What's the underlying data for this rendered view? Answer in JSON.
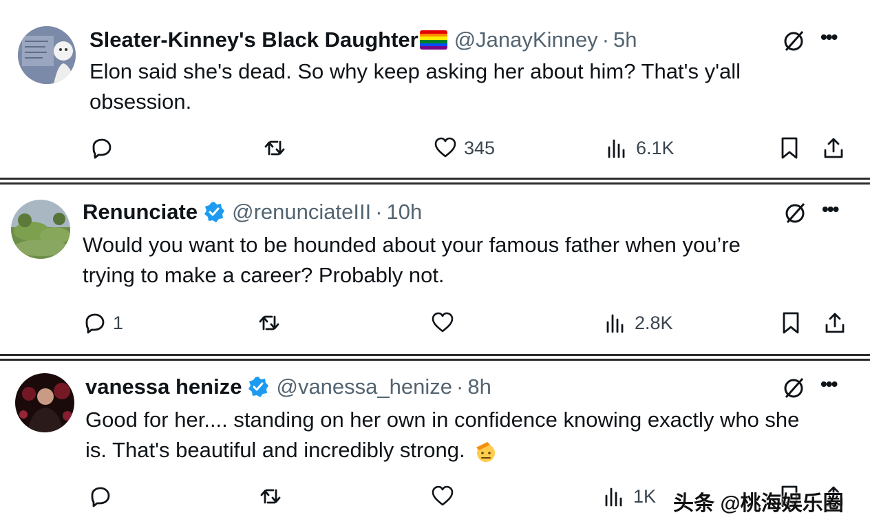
{
  "tweets": [
    {
      "name": "Sleater-Kinney's Black Daughter",
      "handle": "@JanayKinney",
      "separator": "·",
      "time": "5h",
      "text_line1": "Elon said she's dead. So why keep asking her about him? That's y'all",
      "text_line2": "obsession.",
      "reply_count": "",
      "like_count": "345",
      "view_count": "6.1K",
      "verified": false
    },
    {
      "name": "Renunciate",
      "handle": "@renunciateIII",
      "separator": "·",
      "time": "10h",
      "text_line1": "Would you want to be hounded about your famous father when you’re",
      "text_line2": "trying to make a career? Probably not.",
      "reply_count": "1",
      "like_count": "",
      "view_count": "2.8K",
      "verified": true
    },
    {
      "name": "vanessa henize",
      "handle": "@vanessa_henize",
      "separator": "·",
      "time": "8h",
      "text_line1": "Good for her.... standing on her own in confidence knowing exactly who she",
      "text_line2": "is. That's beautiful and incredibly strong.",
      "reply_count": "",
      "like_count": "",
      "view_count": "1K",
      "verified": true
    }
  ],
  "icons": {
    "reply": "reply-icon",
    "retweet": "retweet-icon",
    "like": "heart-icon",
    "views": "views-icon",
    "bookmark": "bookmark-icon",
    "share": "share-icon",
    "grok": "grok-icon",
    "more": "more-icon"
  },
  "watermark": "头条 @桃海娱乐圈",
  "colors": {
    "text": "#0f1419",
    "secondary": "#536471",
    "verified": "#1d9bf0",
    "divider": "#2b2b2b"
  }
}
